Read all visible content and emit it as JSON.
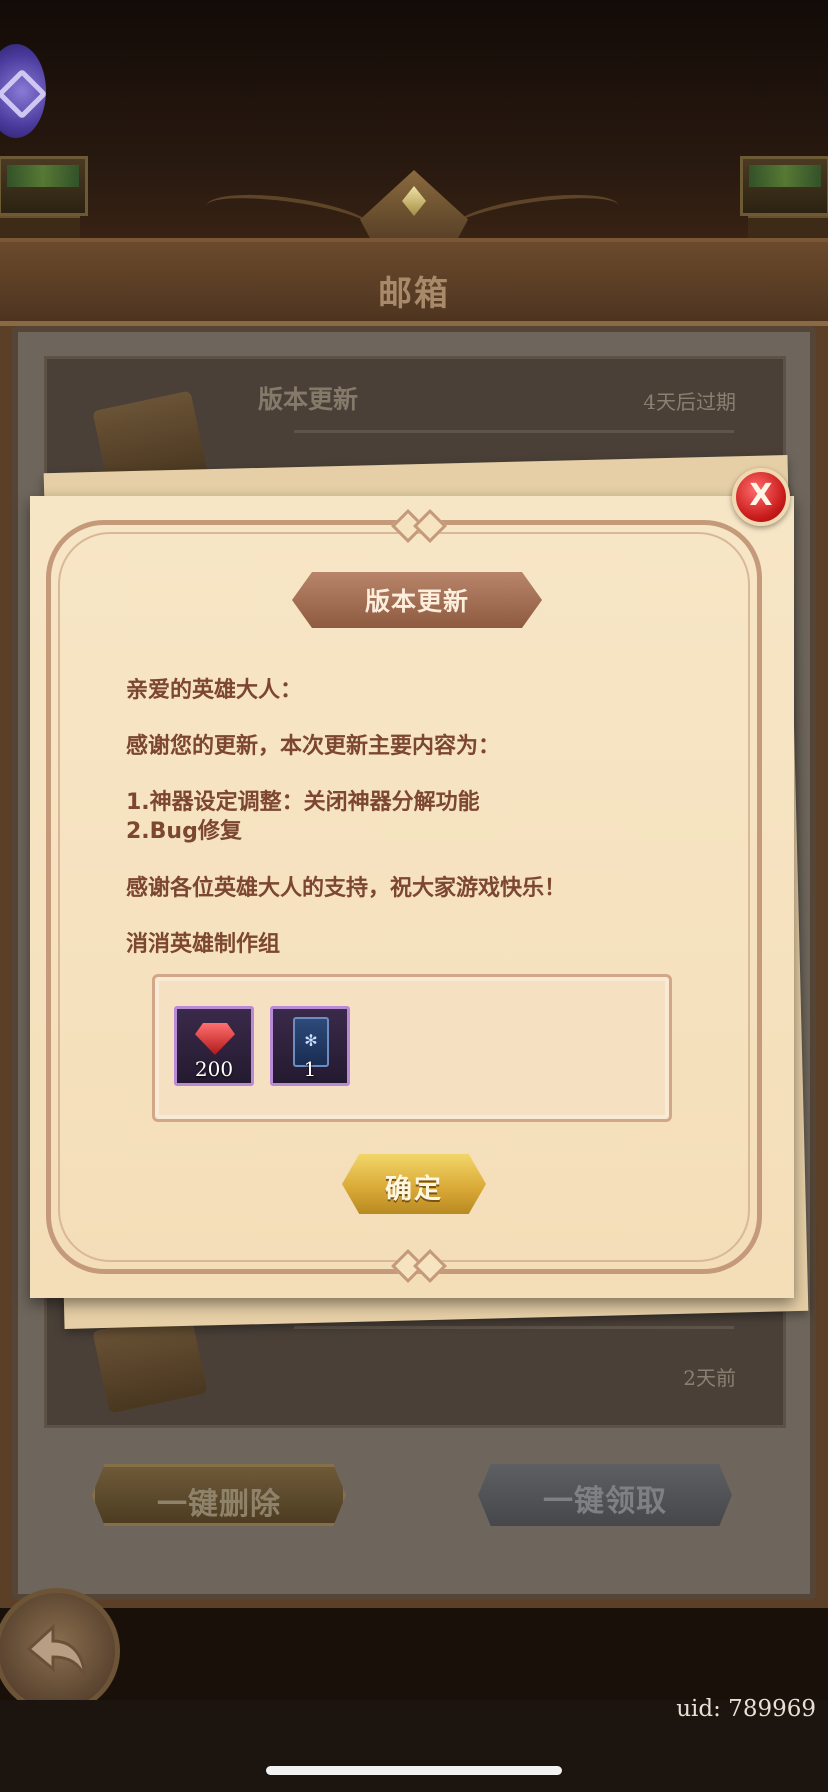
{
  "mailbox": {
    "title": "邮箱",
    "mails": [
      {
        "subject": "版本更新",
        "expiry": "4天后过期"
      },
      {
        "subject": "",
        "expiry": "2天前"
      }
    ],
    "delete_all_label": "一键删除",
    "claim_all_label": "一键领取"
  },
  "dialog": {
    "close_label": "X",
    "title": "版本更新",
    "greeting": "亲爱的英雄大人：",
    "thanks": "感谢您的更新，本次更新主要内容为：",
    "items": [
      "1.神器设定调整：关闭神器分解功能",
      "2.Bug修复"
    ],
    "wishes": "感谢各位英雄大人的支持，祝大家游戏快乐！",
    "signature": "消消英雄制作组",
    "rewards": [
      {
        "icon": "ruby-gem-icon",
        "quantity": "200"
      },
      {
        "icon": "card-icon",
        "quantity": "1"
      }
    ],
    "confirm_label": "确定"
  },
  "footer": {
    "uid": "uid: 789969"
  },
  "colors": {
    "text_brown": "#7c4630",
    "parchment": "#f7e6c6",
    "close_red": "#c81a1a",
    "confirm_gold": "#d8a734"
  }
}
